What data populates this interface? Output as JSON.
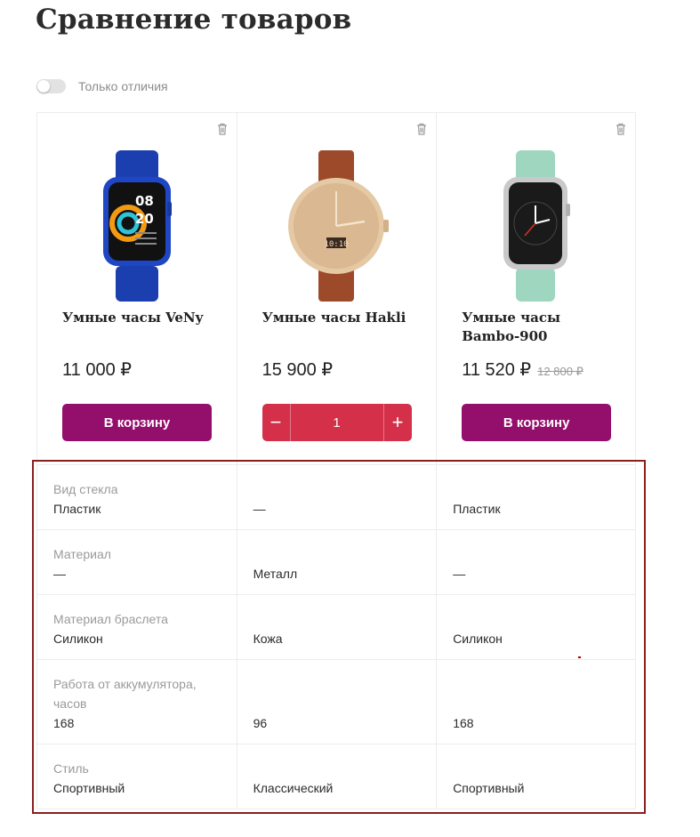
{
  "page": {
    "title": "Сравнение товаров"
  },
  "filter": {
    "only_differences_label": "Только отличия",
    "only_differences_on": false
  },
  "colors": {
    "cart_button": "#940f6c",
    "stepper": "#d4304a",
    "highlight_border": "#8a1f1f"
  },
  "products": [
    {
      "name": "Умные часы VeNy",
      "price": "11 000 ₽",
      "old_price": "",
      "cart_label": "В корзину",
      "image": "blue-smartwatch"
    },
    {
      "name": "Умные часы Hakli",
      "price": "15 900 ₽",
      "old_price": "",
      "quantity": "1",
      "minus": "−",
      "plus": "+",
      "image": "gold-analog-watch"
    },
    {
      "name": "Умные часы Bambo-900",
      "price": "11 520 ₽",
      "old_price": "12 800 ₽",
      "cart_label": "В корзину",
      "image": "mint-smartwatch"
    }
  ],
  "specs": [
    {
      "label": "Вид стекла",
      "values": [
        "Пластик",
        "—",
        "Пластик"
      ]
    },
    {
      "label": "Материал",
      "values": [
        "—",
        "Металл",
        "—"
      ]
    },
    {
      "label": "Материал браслета",
      "values": [
        "Силикон",
        "Кожа",
        "Силикон"
      ]
    },
    {
      "label": "Работа от аккумулятора, часов",
      "values": [
        "168",
        "96",
        "168"
      ]
    },
    {
      "label": "Стиль",
      "values": [
        "Спортивный",
        "Классический",
        "Спортивный"
      ]
    }
  ]
}
